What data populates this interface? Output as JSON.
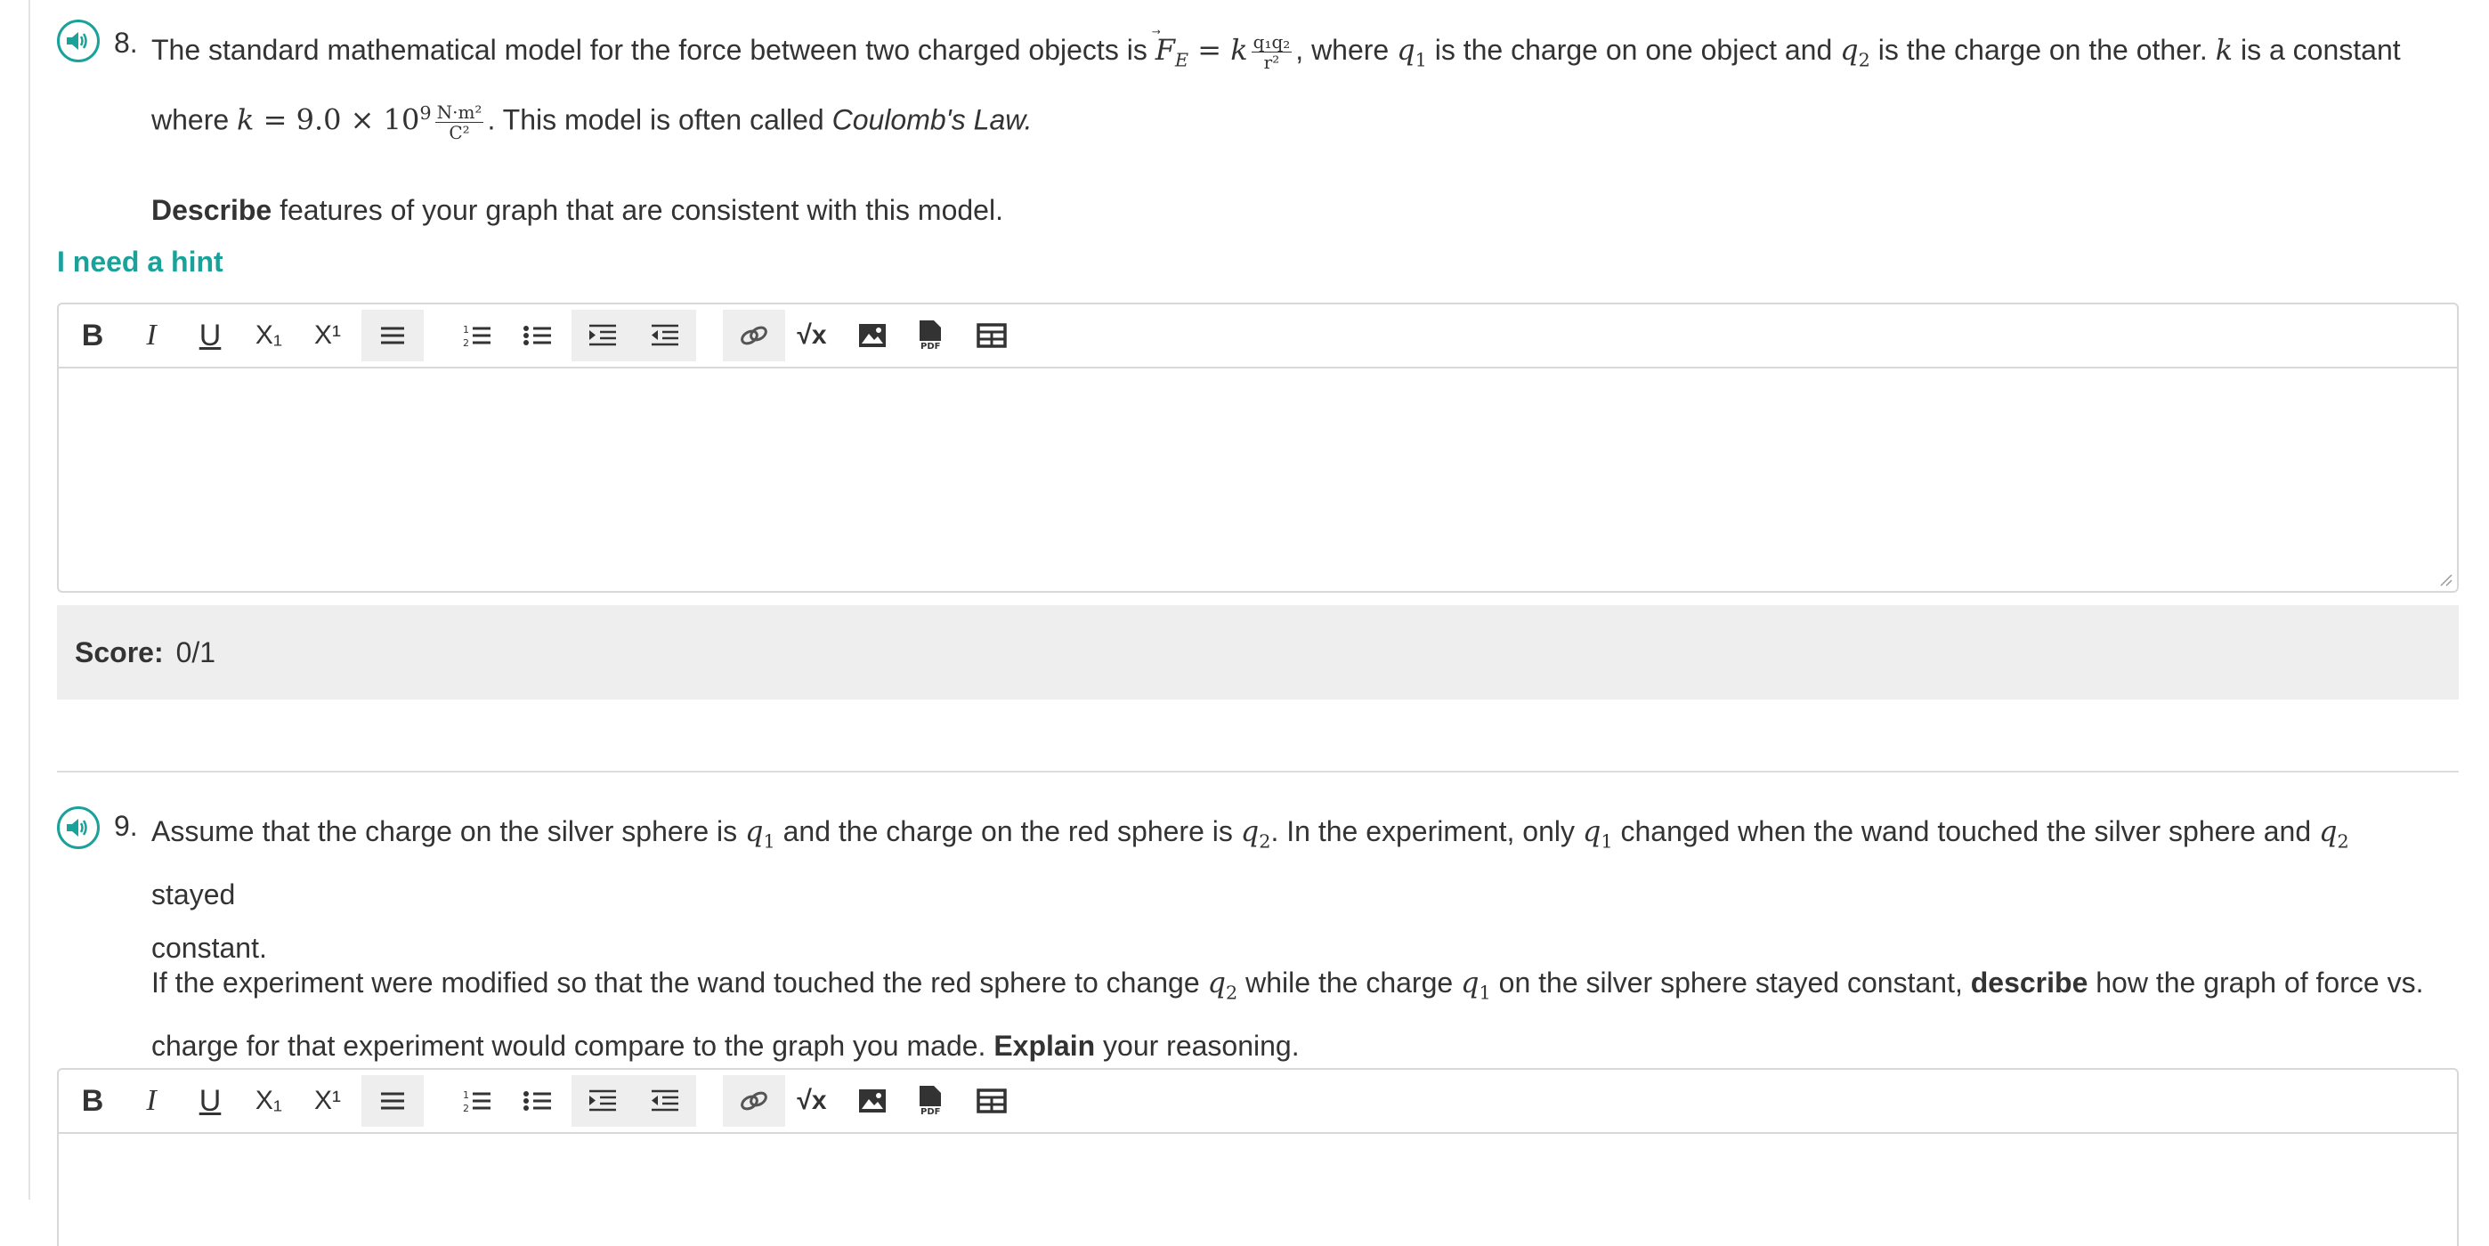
{
  "q8": {
    "number": "8.",
    "line1_a": "The standard mathematical model for the force between two charged objects is ",
    "line1_b": ", where ",
    "line1_c": " is the charge on one object and ",
    "line1_d": " is the charge on the other. ",
    "line1_e": " is a constant",
    "line2_a": "where ",
    "line2_b": ". This model is often called ",
    "law_name": "Coulomb's Law.",
    "describe_bold": "Describe",
    "describe_rest": " features of your graph that are consistent with this model.",
    "hint": "I need a hint",
    "score_label": "Score:",
    "score_value": "0/1"
  },
  "q9": {
    "number": "9.",
    "p1_a": "Assume that the charge on the silver sphere is ",
    "p1_b": " and the charge on the red sphere is ",
    "p1_c": ". In the experiment, only ",
    "p1_d": " changed when the wand touched the silver sphere and ",
    "p1_e": " stayed",
    "p1_f": "constant.",
    "p2_a": "If the experiment were modified so that the wand touched the red sphere to change ",
    "p2_b": " while the charge ",
    "p2_c": " on the silver sphere stayed constant, ",
    "p2_bold1": "describe",
    "p2_d": " how the graph of force vs.",
    "p2_e": "charge for that experiment would compare to the graph you made. ",
    "p2_bold2": "Explain",
    "p2_f": " your reasoning."
  },
  "math": {
    "F": "F",
    "E": "E",
    "eq": " = ",
    "k": "k",
    "q": "q",
    "one": "1",
    "two": "2",
    "frac_num": "q₁q₂",
    "frac_den": "r²",
    "k_value": " = 9.0 × 10",
    "exp": "9",
    "unit_num": "N·m²",
    "unit_den": "C²"
  },
  "toolbar": {
    "bold": "B",
    "italic": "I",
    "underline": "U",
    "subscript": "X₁",
    "superscript": "X¹",
    "sqrt": "√x",
    "pdf": "PDF"
  },
  "colors": {
    "accent": "#1aa19a",
    "score_bg": "#eeeeee",
    "group_bg": "#eeeeee"
  }
}
